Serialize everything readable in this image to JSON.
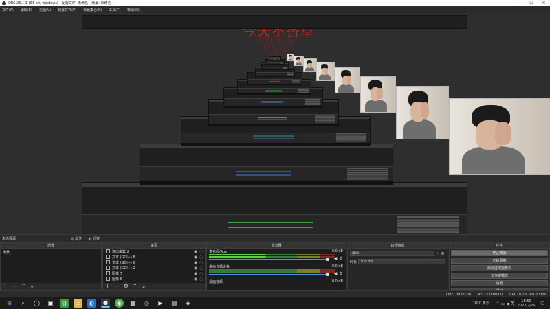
{
  "titlebar": {
    "title": "OBS 26.1.1 (64-bit, windows) - 配置文件: 未命名 - 场景: 未命名",
    "minimize": "—",
    "maximize": "☐",
    "close": "✕"
  },
  "menu": [
    "文件(F)",
    "编辑(E)",
    "视图(V)",
    "配置文件(P)",
    "场景集合(S)",
    "工具(T)",
    "帮助(H)"
  ],
  "preview": {
    "overlay_text": "今天不香草"
  },
  "scene_bar": {
    "label": "未选择源",
    "properties": "⚙ 属性",
    "filters": "◐ 滤镜"
  },
  "scenes_panel": {
    "header": "场景",
    "items": [
      "场景"
    ],
    "footer": [
      "+",
      "—",
      "⌃",
      "⌄"
    ]
  },
  "sources_panel": {
    "header": "来源",
    "items": [
      {
        "name": "窗口采集 2",
        "icon": "window-capture-icon"
      },
      {
        "name": "文本 (GDI+) 8",
        "icon": "text-icon"
      },
      {
        "name": "文本 (GDI+) 6",
        "icon": "text-icon"
      },
      {
        "name": "文本 (GDI+) 2",
        "icon": "text-icon"
      },
      {
        "name": "图像 7",
        "icon": "image-icon"
      },
      {
        "name": "图像 6",
        "icon": "image-icon"
      }
    ],
    "footer": [
      "+",
      "—",
      "⚙",
      "⌃",
      "⌄"
    ]
  },
  "mixer_panel": {
    "header": "混音器",
    "channels": [
      {
        "name": "麦克风/Aux",
        "db": "0.0 dB",
        "active": true
      },
      {
        "name": "桌面音频设备",
        "db": "0.0 dB",
        "active": false
      },
      {
        "name": "桌面音频",
        "db": "0.0 dB",
        "active": false
      }
    ]
  },
  "transitions_panel": {
    "header": "转场特效",
    "type": "淡出",
    "duration_label": "时长",
    "duration_value": "300 ms"
  },
  "controls_panel": {
    "header": "控件",
    "buttons": [
      "停止推流",
      "开始录制",
      "启动虚拟摄像机",
      "工作室模式",
      "设置",
      "退出"
    ]
  },
  "status": {
    "live": "LIVE: 00:00:00",
    "rec": "REC: 00:00:00",
    "cpu": "CPU: 0.7%, 60.00 fps"
  },
  "taskbar": {
    "weather": "10°C 多云",
    "time": "18:50",
    "date": "2022/2/25"
  },
  "colors": {
    "accent": "#4a90e2",
    "meter_green": "#58d33a",
    "overlay_red": "#d61d1d"
  }
}
